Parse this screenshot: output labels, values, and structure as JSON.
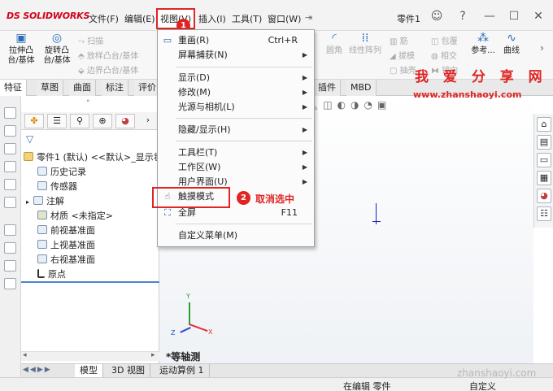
{
  "app": {
    "logo": "DS SOLIDWORKS",
    "doc_title": "零件1"
  },
  "menubar": {
    "items": [
      "文件(F)",
      "编辑(E)",
      "视图(V)",
      "插入(I)",
      "工具(T)",
      "窗口(W)"
    ],
    "pin": "⇥"
  },
  "ribbon": {
    "extrude_boss": "拉伸凸\n台/基体",
    "revolve_boss": "旋转凸\n台/基体",
    "sweep": "扫描",
    "loft": "放样凸台/基体",
    "boundary": "边界凸台/基体",
    "fillet": "圆角",
    "linear_pattern": "线性阵列",
    "rib": "筋",
    "wrap": "包覆",
    "draft": "拔模",
    "intersect": "相交",
    "shell": "抽壳",
    "mirror": "镜向",
    "reference": "参考...",
    "curves": "曲线"
  },
  "cmd_tabs": [
    "特征",
    "草图",
    "曲面",
    "标注",
    "评价"
  ],
  "cmd_tabs_right": [
    "插件",
    "MBD"
  ],
  "feature_tree": {
    "root": "零件1 (默认) <<默认>_显示状",
    "items": [
      "历史记录",
      "传感器",
      "注解",
      "材质 <未指定>",
      "前视基准面",
      "上视基准面",
      "右视基准面",
      "原点"
    ]
  },
  "dropdown": {
    "items": [
      {
        "label": "重画(R)",
        "shortcut": "Ctrl+R"
      },
      {
        "label": "屏幕捕获(N)",
        "shortcut": ""
      },
      {
        "label": "显示(D)",
        "shortcut": ""
      },
      {
        "label": "修改(M)",
        "shortcut": ""
      },
      {
        "label": "光源与相机(L)",
        "shortcut": ""
      },
      {
        "label": "隐藏/显示(H)",
        "shortcut": ""
      },
      {
        "label": "工具栏(T)",
        "shortcut": ""
      },
      {
        "label": "工作区(W)",
        "shortcut": ""
      },
      {
        "label": "用户界面(U)",
        "shortcut": ""
      },
      {
        "label": "触摸模式",
        "shortcut": ""
      },
      {
        "label": "全屏",
        "shortcut": "F11"
      },
      {
        "label": "自定义菜单(M)",
        "shortcut": ""
      }
    ]
  },
  "annotations": {
    "badge1": "1",
    "badge2": "2",
    "cancel": "取消选中"
  },
  "viewport": {
    "view_label": "*等轴测",
    "watermark": "我 爱 分 享 网",
    "watermark_url": "www.zhanshaoyi.com",
    "watermark_bottom": "zhanshaoyi.com"
  },
  "bottom_tabs": [
    "模型",
    "3D 视图",
    "运动算例 1"
  ],
  "status": {
    "editing": "在编辑 零件",
    "custom": "自定义"
  },
  "colors": {
    "highlight": "#e02424",
    "brand": "#d0021b"
  }
}
